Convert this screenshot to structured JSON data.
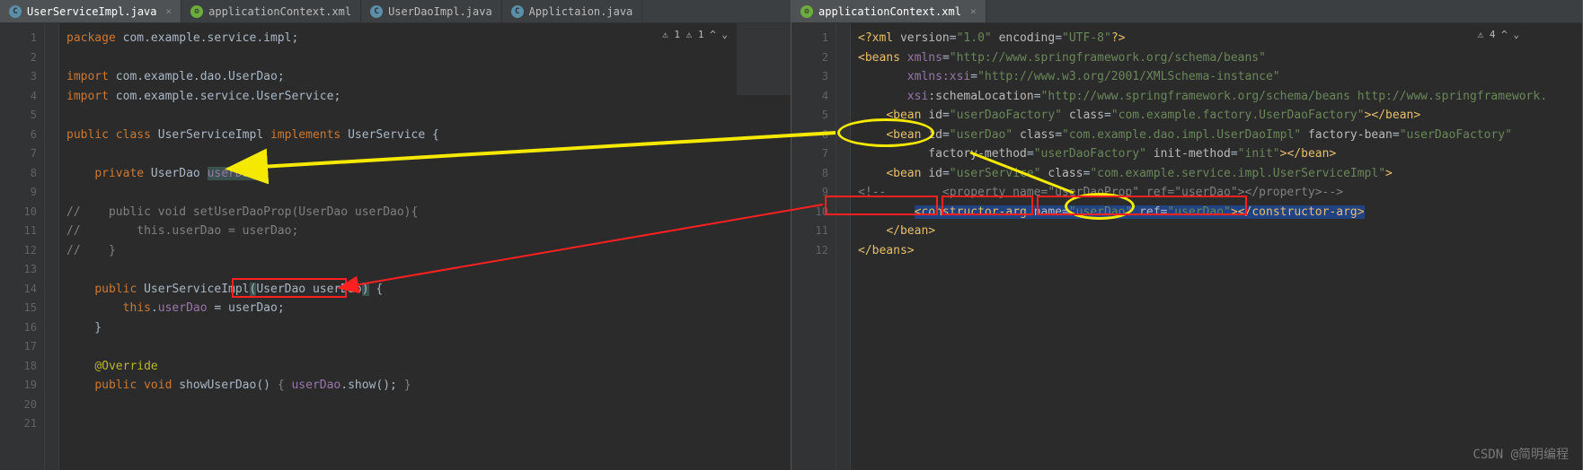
{
  "left": {
    "tabs": [
      {
        "label": "UserServiceImpl.java",
        "icon": "java",
        "active": true
      },
      {
        "label": "applicationContext.xml",
        "icon": "xml",
        "active": false
      },
      {
        "label": "UserDaoImpl.java",
        "icon": "java",
        "active": false
      },
      {
        "label": "Applictaion.java",
        "icon": "java",
        "active": false
      }
    ],
    "warnings": "⚠ 1 ⚠ 1 ^ ⌄",
    "lines": {
      "1": "package com.example.service.impl;",
      "3a": "import com.example.dao.UserDao;",
      "4a": "import com.example.service.UserService;",
      "6a": "public class UserServiceImpl implements UserService {",
      "8a": "    private UserDao userDao;",
      "10a": "//    public void setUserDaoProp(UserDao userDao){",
      "11a": "//        this.userDao = userDao;",
      "12a": "//    }",
      "14a": "    public UserServiceImpl(UserDao userDao) {",
      "15a": "        this.userDao = userDao;",
      "16a": "    }",
      "18a": "    @Override",
      "19a": "    public void showUserDao() { userDao.show(); }"
    },
    "lineNums": [
      "1",
      "2",
      "3",
      "4",
      "5",
      "6",
      "7",
      "8",
      "9",
      "10",
      "11",
      "12",
      "13",
      "14",
      "15",
      "16",
      "17",
      "18",
      "19",
      "20",
      "21"
    ]
  },
  "right": {
    "tabs": [
      {
        "label": "applicationContext.xml",
        "icon": "xml",
        "active": true
      }
    ],
    "warnings": "⚠ 4 ^ ⌄",
    "lines": {
      "1": "<?xml version=\"1.0\" encoding=\"UTF-8\"?>",
      "2": "<beans xmlns=\"http://www.springframework.org/schema/beans\"",
      "3": "       xmlns:xsi=\"http://www.w3.org/2001/XMLSchema-instance\"",
      "4": "       xsi:schemaLocation=\"http://www.springframework.org/schema/beans http://www.springframework.",
      "5": "    <bean id=\"userDaoFactory\" class=\"com.example.factory.UserDaoFactory\"></bean>",
      "6": "    <bean id=\"userDao\" class=\"com.example.dao.impl.UserDaoImpl\" factory-bean=\"userDaoFactory\"",
      "7": "          factory-method=\"userDaoFactory\" init-method=\"init\"></bean>",
      "8": "    <bean id=\"userService\" class=\"com.example.service.impl.UserServiceImpl\">",
      "9": "<!--        <property name=\"userDaoProp\" ref=\"userDao\"></property>-->",
      "10": "        <constructor-arg name=\"userDao\" ref=\"userDao\"></constructor-arg>",
      "11": "    </bean>",
      "12": "</beans>"
    },
    "lineNums": [
      "1",
      "2",
      "3",
      "4",
      "5",
      "6",
      "7",
      "8",
      "9",
      "10",
      "11",
      "12"
    ]
  },
  "watermark": "CSDN @简明编程"
}
